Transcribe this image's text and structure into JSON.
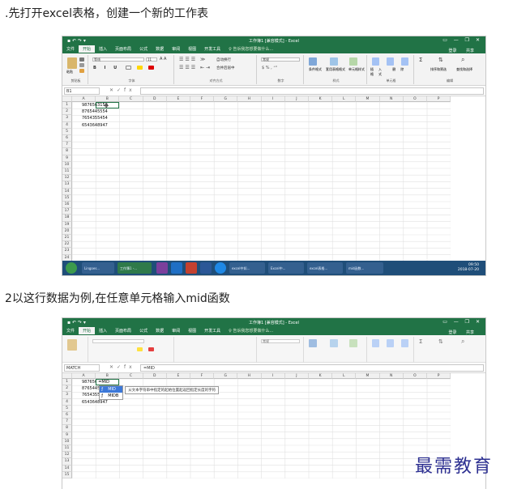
{
  "step1": {
    "text": ".先打开excel表格，创建一个新的工作表",
    "window_title": "工作簿1 [兼容模式] - Excel",
    "tabs": [
      "文件",
      "开始",
      "插入",
      "页面布局",
      "公式",
      "数据",
      "审阅",
      "视图",
      "开发工具"
    ],
    "tell_me": "♀ 告诉我您想要做什么...",
    "account": "登录",
    "share": "共享",
    "font_name": "等线",
    "font_size": "11",
    "number_format": "常规",
    "wrap_text": "自动换行",
    "merge_center": "合并后居中",
    "groups": [
      "剪贴板",
      "字体",
      "对齐方式",
      "数字",
      "样式",
      "单元格",
      "编辑"
    ],
    "style_buttons": [
      "条件格式",
      "套用表格格式",
      "单元格样式"
    ],
    "cell_buttons": [
      "插入",
      "删除",
      "格式"
    ],
    "edit_buttons": [
      "排序和筛选",
      "查找和选择"
    ],
    "paste_label": "粘贴",
    "name_box": "B1",
    "formula": "",
    "columns": [
      "A",
      "B",
      "C",
      "D",
      "E",
      "F",
      "G",
      "H",
      "I",
      "J",
      "K",
      "L",
      "M",
      "N",
      "O",
      "P"
    ],
    "rows": [
      "1",
      "2",
      "3",
      "4",
      "5",
      "6",
      "7",
      "8",
      "9",
      "10",
      "11",
      "12",
      "13",
      "14",
      "15",
      "16",
      "17",
      "18",
      "19",
      "20",
      "21",
      "22",
      "23",
      "24"
    ],
    "values": [
      "9876563150",
      "8765445554",
      "7654355454",
      "6543648947"
    ],
    "taskbar_items": [
      "Lingoes...",
      "工作簿1 -...",
      "",
      "",
      "",
      "",
      "excel中如...",
      "Excel中...",
      "excel表格...",
      "mid函数..."
    ],
    "clock_time": "09:50",
    "clock_date": "2018-07-20"
  },
  "step2": {
    "text": "2以这行数据为例,在任意单元格输入mid函数",
    "window_title": "工作簿1 [兼容模式] - Excel",
    "name_box": "MATCH",
    "formula": "=MID",
    "cell_input": "=MID",
    "autocomplete": [
      "MID",
      "MIDB"
    ],
    "tooltip": "从文本字符串中指定的起始位置起返回指定长度的字符",
    "columns": [
      "A",
      "B",
      "C",
      "D",
      "E",
      "F",
      "G",
      "H",
      "I",
      "J",
      "K",
      "L",
      "M",
      "N",
      "O",
      "P"
    ],
    "rows": [
      "1",
      "2",
      "3",
      "4",
      "5",
      "6",
      "7",
      "8",
      "9",
      "10",
      "11",
      "12",
      "13",
      "14",
      "15"
    ],
    "values": [
      "9876563150",
      "8765445554",
      "7654355454",
      "6543648947"
    ]
  },
  "watermark": "最需教育",
  "colors": {
    "excel_green": "#217346",
    "taskbar": "#1f4e79",
    "watermark": "#2e3192"
  }
}
